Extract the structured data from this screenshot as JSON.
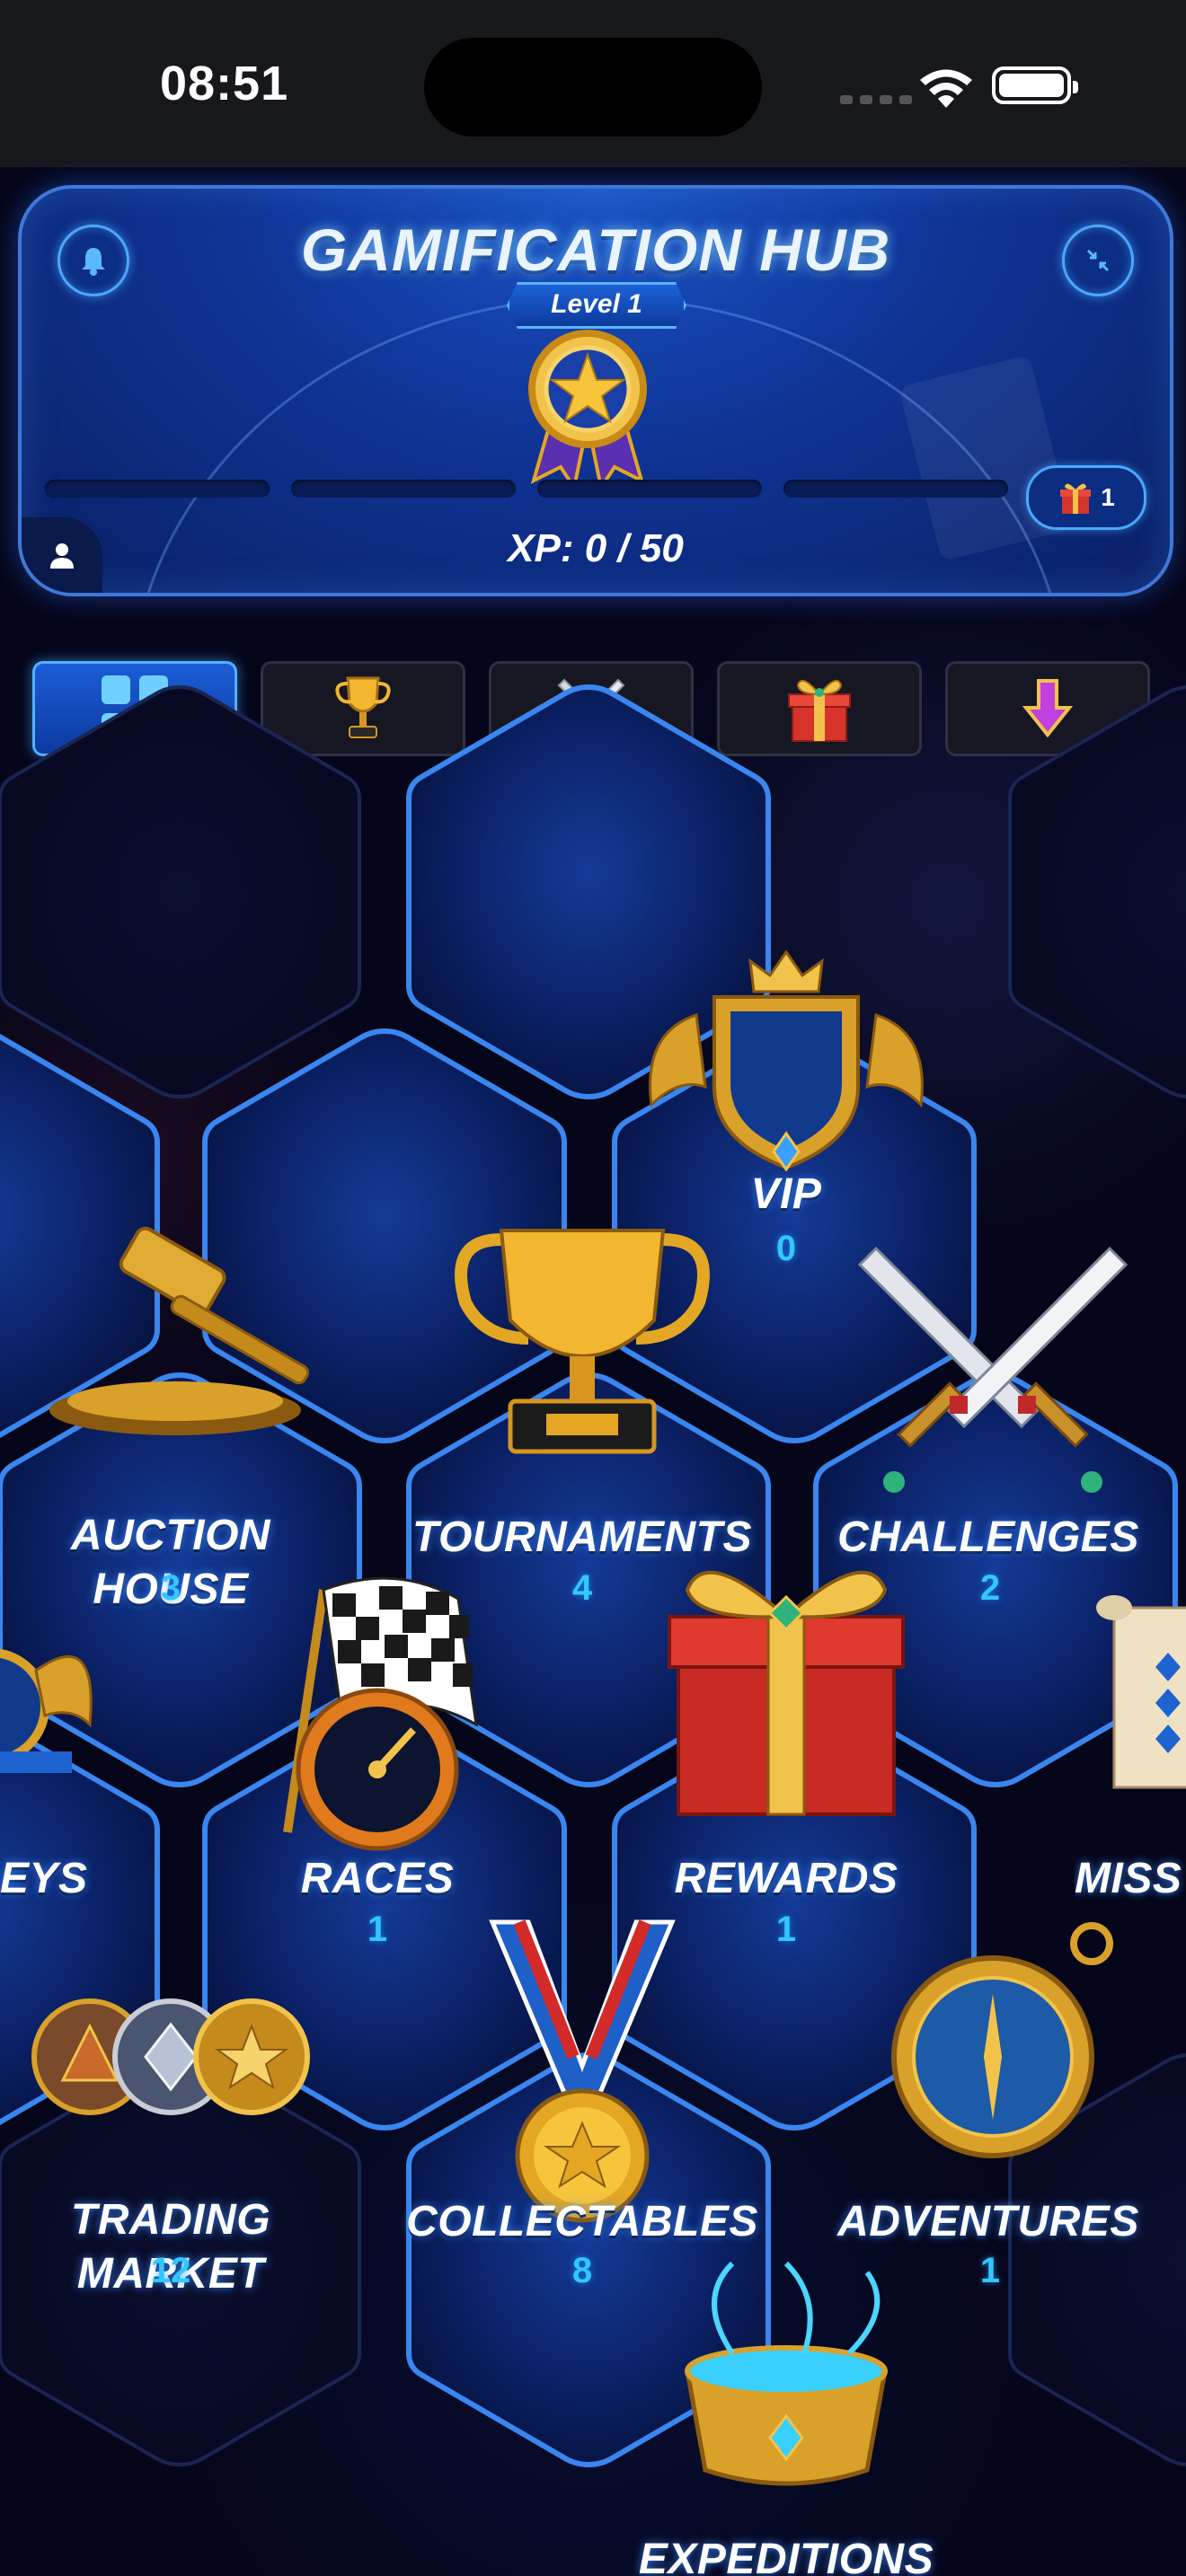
{
  "status_bar": {
    "time": "08:51"
  },
  "header": {
    "title": "GAMIFICATION HUB",
    "level_label": "Level 1",
    "xp_text": "XP: 0 / 50",
    "gift_count": "1",
    "xp_progress": 0
  },
  "filter_tabs": [
    {
      "icon": "grid-icon",
      "active": true
    },
    {
      "icon": "trophy-icon",
      "active": false
    },
    {
      "icon": "crossed-swords-icon",
      "active": false
    },
    {
      "icon": "gift-icon",
      "active": false
    },
    {
      "icon": "down-arrow-icon",
      "active": false
    }
  ],
  "hub_tiles": [
    {
      "label": "VIP",
      "count": "0",
      "icon": "shield-crown-icon"
    },
    {
      "label": "AUCTION\nHOUSE",
      "count": "3",
      "icon": "gavel-icon"
    },
    {
      "label": "TOURNAMENTS",
      "count": "4",
      "icon": "trophy-icon"
    },
    {
      "label": "CHALLENGES",
      "count": "2",
      "icon": "crossed-swords-icon"
    },
    {
      "label": "EYS",
      "count": "",
      "icon": "winged-emblem-icon"
    },
    {
      "label": "RACES",
      "count": "1",
      "icon": "checkered-flag-icon"
    },
    {
      "label": "REWARDS",
      "count": "1",
      "icon": "gift-box-icon"
    },
    {
      "label": "MISS",
      "count": "",
      "icon": "scroll-icon"
    },
    {
      "label": "TRADING\nMARKET",
      "count": "12",
      "icon": "coins-icon"
    },
    {
      "label": "COLLECTABLES",
      "count": "8",
      "icon": "medal-icon"
    },
    {
      "label": "ADVENTURES",
      "count": "1",
      "icon": "compass-icon"
    },
    {
      "label": "EXPEDITIONS",
      "count": "",
      "icon": "cauldron-icon"
    }
  ],
  "colors": {
    "accent": "#33c6ff",
    "hex_border": "#2f6fe0",
    "hex_fill": "#0a1f5c",
    "gold": "#e3a724"
  }
}
